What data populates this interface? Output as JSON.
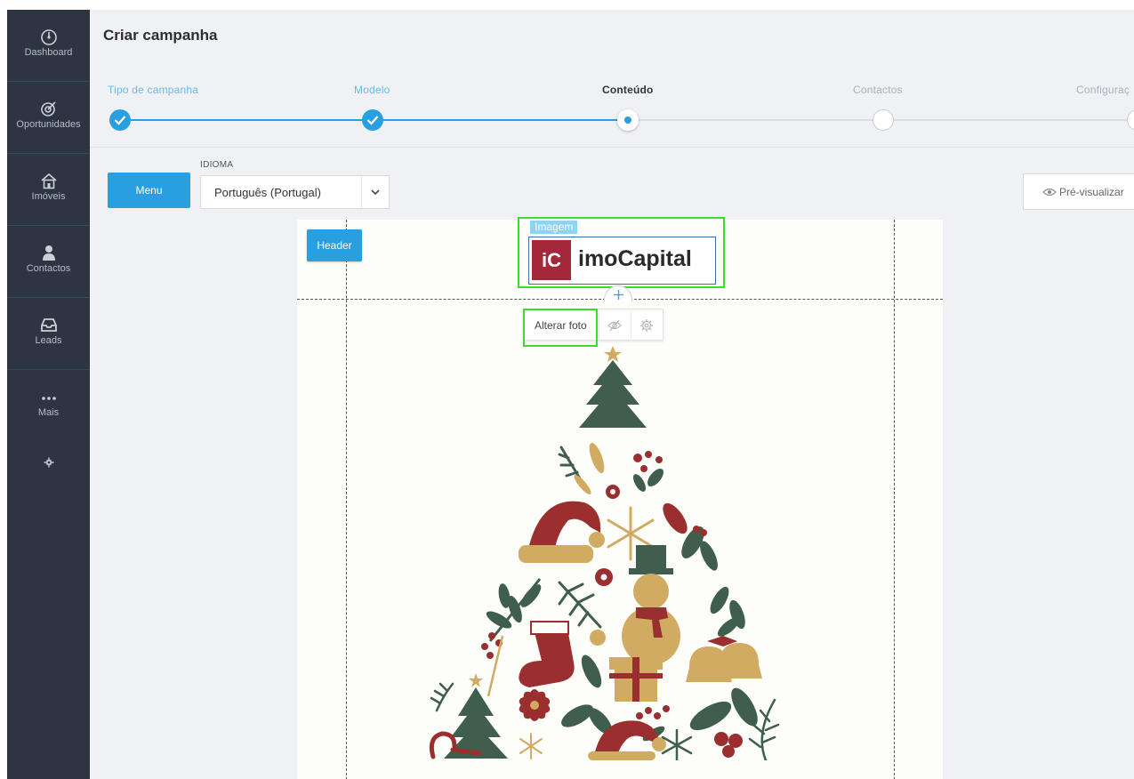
{
  "sidebar": {
    "items": [
      {
        "label": "Dashboard",
        "icon": "speedometer-icon"
      },
      {
        "label": "Oportunidades",
        "icon": "target-icon"
      },
      {
        "label": "Imóveis",
        "icon": "house-icon"
      },
      {
        "label": "Contactos",
        "icon": "person-icon"
      },
      {
        "label": "Leads",
        "icon": "inbox-icon"
      },
      {
        "label": "Mais",
        "icon": "ellipsis-icon"
      }
    ],
    "settings_icon": "gear-icon"
  },
  "page": {
    "title": "Criar campanha"
  },
  "stepper": {
    "steps": [
      {
        "label": "Tipo de campanha",
        "state": "done"
      },
      {
        "label": "Modelo",
        "state": "done"
      },
      {
        "label": "Conteúdo",
        "state": "active"
      },
      {
        "label": "Contactos",
        "state": "todo"
      },
      {
        "label": "Configuraç",
        "state": "todo"
      }
    ]
  },
  "toolbar": {
    "menu_label": "Menu",
    "language_label": "IDIOMA",
    "language_value": "Português (Portugal)",
    "preview_label": "Pré-visualizar"
  },
  "editor": {
    "header_tag": "Header",
    "image_tag": "Imagem",
    "logo_mark": "iC",
    "logo_text": "imoCapital",
    "change_photo_label": "Alterar foto",
    "hide_icon": "eye-slash-icon",
    "settings_icon": "gear-icon"
  },
  "colors": {
    "sidebar_bg": "#2c3541",
    "accent_blue": "#2a9fe0",
    "highlight_green": "#3ade2f",
    "logo_red": "#a4283a",
    "tree_green": "#3f5e4e",
    "tree_red": "#9b2f2f",
    "tree_gold": "#d1ab62"
  }
}
